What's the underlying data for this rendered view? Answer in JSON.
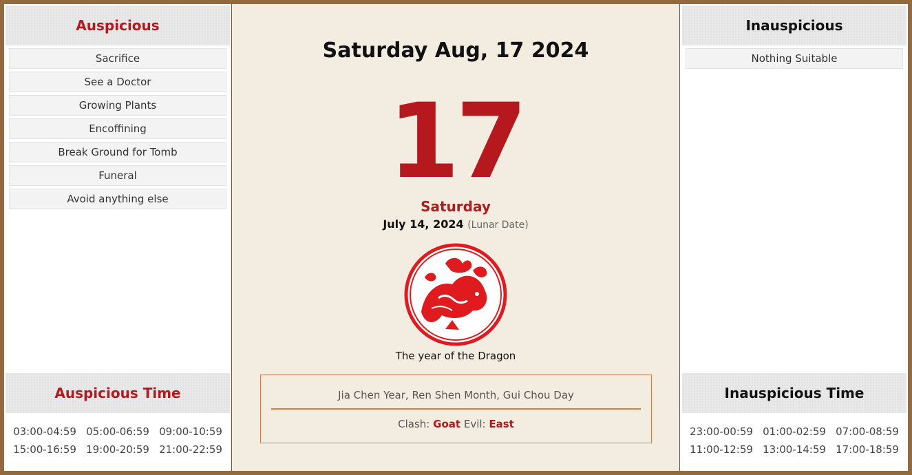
{
  "auspicious": {
    "title": "Auspicious",
    "items": [
      "Sacrifice",
      "See a Doctor",
      "Growing Plants",
      "Encoffining",
      "Break Ground for Tomb",
      "Funeral",
      "Avoid anything else"
    ]
  },
  "inauspicious": {
    "title": "Inauspicious",
    "items": [
      "Nothing Suitable"
    ]
  },
  "auspicious_time": {
    "title": "Auspicious Time",
    "slots": [
      "03:00-04:59",
      "05:00-06:59",
      "09:00-10:59",
      "15:00-16:59",
      "19:00-20:59",
      "21:00-22:59"
    ]
  },
  "inauspicious_time": {
    "title": "Inauspicious Time",
    "slots": [
      "23:00-00:59",
      "01:00-02:59",
      "07:00-08:59",
      "11:00-12:59",
      "13:00-14:59",
      "17:00-18:59"
    ]
  },
  "center": {
    "full_date": "Saturday Aug, 17 2024",
    "day_number": "17",
    "weekday": "Saturday",
    "lunar_date": "July 14, 2024",
    "lunar_label": "(Lunar Date)",
    "zodiac_icon": "dragon-papercut-icon",
    "zodiac_caption": "The year of the Dragon",
    "ganzhi": "Jia Chen Year, Ren Shen Month, Gui Chou Day",
    "clash_label": "Clash:",
    "clash_value": "Goat",
    "evil_label": "Evil:",
    "evil_value": "East"
  },
  "colors": {
    "accent_red": "#b5191e",
    "frame_brown": "#946a3c",
    "info_border": "#e07b45"
  }
}
